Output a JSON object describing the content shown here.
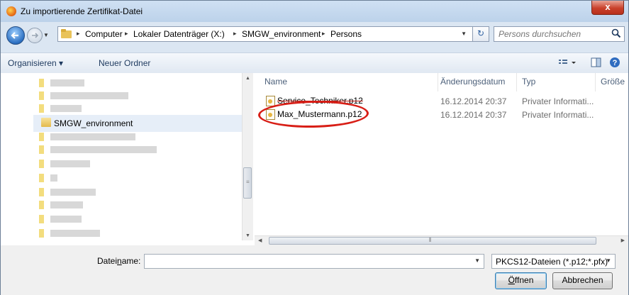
{
  "window": {
    "title": "Zu importierende Zertifikat-Datei",
    "close_label": "x"
  },
  "address": {
    "crumbs": [
      "Computer",
      "Lokaler Datenträger (X:)",
      "SMGW_environment",
      "Persons"
    ],
    "separator": "▸"
  },
  "search": {
    "placeholder": "Persons durchsuchen"
  },
  "toolbar": {
    "organize": "Organisieren ▾",
    "new_folder": "Neuer Ordner"
  },
  "nav": {
    "selected": "SMGW_environment"
  },
  "columns": {
    "name": "Name",
    "date": "Änderungsdatum",
    "type": "Typ",
    "size": "Größe"
  },
  "files": [
    {
      "name": "Service_Techniker.p12",
      "date": "16.12.2014 20:37",
      "type": "Privater Informati..."
    },
    {
      "name": "Max_Mustermann.p12",
      "date": "16.12.2014 20:37",
      "type": "Privater Informati..."
    }
  ],
  "bottom": {
    "filename_label_pre": "Datei",
    "filename_label_u": "n",
    "filename_label_post": "ame:",
    "filename_value": "",
    "filter": "PKCS12-Dateien (*.p12;*.pfx)",
    "open_label_u": "Ö",
    "open_label_rest": "ffnen",
    "cancel_label": "Abbrechen"
  },
  "icons": [
    "firefox-icon",
    "back-arrow-icon",
    "forward-arrow-icon",
    "folder-icon",
    "refresh-icon",
    "search-icon",
    "view-icon",
    "preview-pane-icon",
    "help-icon",
    "certificate-file-icon"
  ],
  "colors": {
    "highlight_ring": "#d81e16",
    "title_bar": "#cfe0f3",
    "selected_nav": "#e6eef8"
  }
}
